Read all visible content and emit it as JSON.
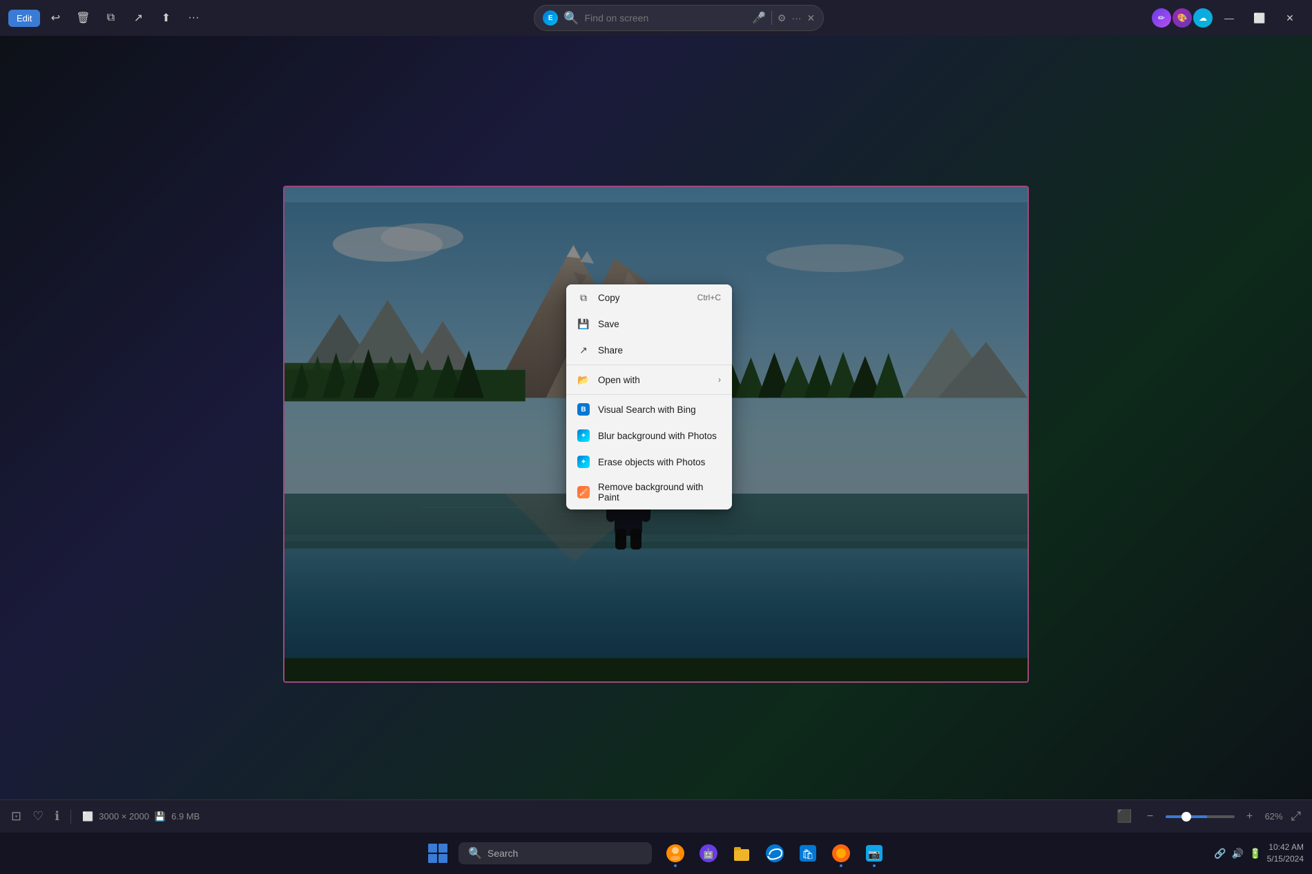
{
  "titlebar": {
    "edit_label": "Edit",
    "search_placeholder": "Find on screen",
    "search_icon": "🔍",
    "mic_icon": "🎤"
  },
  "statusbar": {
    "dimensions": "3000 × 2000",
    "filesize": "6.9 MB",
    "zoom_level": "62%"
  },
  "context_menu": {
    "copy_label": "Copy",
    "copy_shortcut": "Ctrl+C",
    "save_label": "Save",
    "share_label": "Share",
    "open_with_label": "Open with",
    "visual_search_label": "Visual Search with Bing",
    "blur_bg_label": "Blur background with Photos",
    "erase_objects_label": "Erase objects with Photos",
    "remove_bg_label": "Remove background with Paint"
  },
  "taskbar": {
    "search_placeholder": "Search",
    "apps": [
      {
        "name": "windows",
        "icon": "⊞"
      },
      {
        "name": "news",
        "icon": "👤"
      },
      {
        "name": "ai",
        "icon": "🤖"
      },
      {
        "name": "files",
        "icon": "📁"
      },
      {
        "name": "edge",
        "icon": "🌐"
      },
      {
        "name": "store",
        "icon": "🛍"
      },
      {
        "name": "browser2",
        "icon": "🦊"
      },
      {
        "name": "photos",
        "icon": "📷"
      }
    ]
  }
}
